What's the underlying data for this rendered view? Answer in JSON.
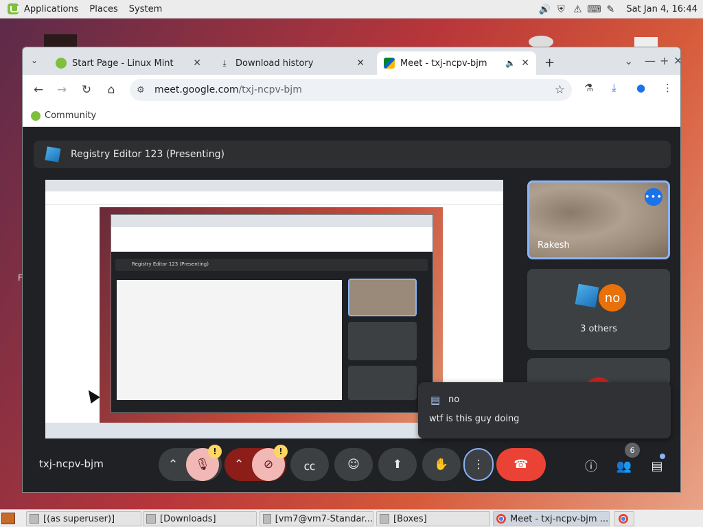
{
  "top_panel": {
    "menus": [
      "Applications",
      "Places",
      "System"
    ],
    "clock": "Sat Jan  4, 16:44",
    "tray_icons": [
      "volume-icon",
      "shield-icon",
      "update-icon",
      "keyboard-icon",
      "pen-icon"
    ]
  },
  "browser": {
    "tabs": [
      {
        "label": "Start Page - Linux Mint",
        "icon": "mint-icon"
      },
      {
        "label": "Download history",
        "icon": "download-icon"
      },
      {
        "label": "Meet - txj-ncpv-bjm",
        "icon": "meet-icon",
        "active": true
      }
    ],
    "url_host": "meet.google.com",
    "url_path": "/txj-ncpv-bjm",
    "bookmark": "Community"
  },
  "meet": {
    "presenting_title": "Registry Editor 123 (Presenting)",
    "meeting_code": "txj-ncpv-bjm",
    "participants": {
      "pinned_name": "Rakesh",
      "others_avatar": "no",
      "others_label": "3 others",
      "count": "6"
    },
    "chat": {
      "sender": "no",
      "message": "wtf is this guy doing"
    },
    "warn_glyph": "!"
  },
  "shared_screen": {
    "present_title": "Registry Editor 123 (Presenting)"
  },
  "taskbar": {
    "items": [
      {
        "label": "[(as superuser)]"
      },
      {
        "label": "[Downloads]"
      },
      {
        "label": "[vm7@vm7-Standar..."
      },
      {
        "label": "[Boxes]"
      },
      {
        "label": "Meet - txj-ncpv-bjm ..."
      }
    ]
  },
  "colors": {
    "accent_blue": "#8ab4f8",
    "end_call_red": "#ea4335",
    "warning_yellow": "#fdd663",
    "mint_green": "#7fbf3f"
  }
}
